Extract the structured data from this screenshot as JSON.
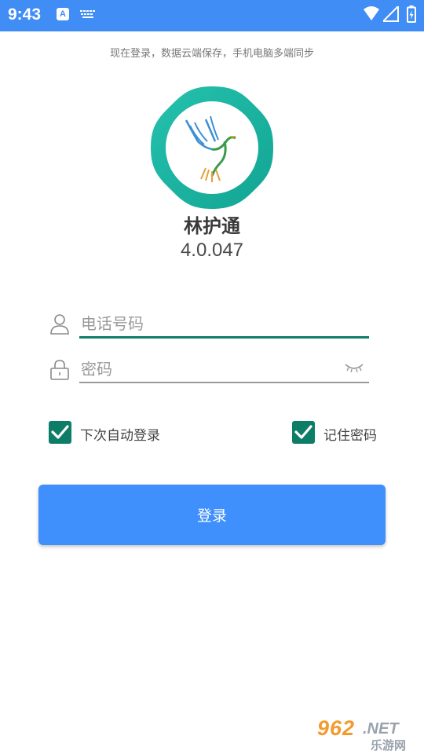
{
  "status_bar": {
    "time": "9:43",
    "icons": [
      "a-notification-icon",
      "keyboard-icon",
      "wifi-icon",
      "signal-icon",
      "battery-icon"
    ]
  },
  "header": {
    "tagline": "现在登录，数据云端保存，手机电脑多端同步"
  },
  "app": {
    "name": "林护通",
    "version": "4.0.047",
    "logo_icon": "dove-logo",
    "logo_color": "#1fb5a2"
  },
  "form": {
    "phone": {
      "placeholder": "电话号码",
      "value": "",
      "icon": "user-icon"
    },
    "password": {
      "placeholder": "密码",
      "value": "",
      "icon": "lock-icon",
      "toggle_icon": "eye-closed-icon"
    },
    "auto_login": {
      "label": "下次自动登录",
      "checked": true
    },
    "remember_password": {
      "label": "记住密码",
      "checked": true
    },
    "submit_label": "登录"
  },
  "colors": {
    "status_bar": "#3f8df5",
    "accent": "#0e7d68",
    "button": "#3f8ffc"
  },
  "watermark": {
    "number": "962",
    "suffix": ".NET",
    "chinese": "乐游网"
  }
}
